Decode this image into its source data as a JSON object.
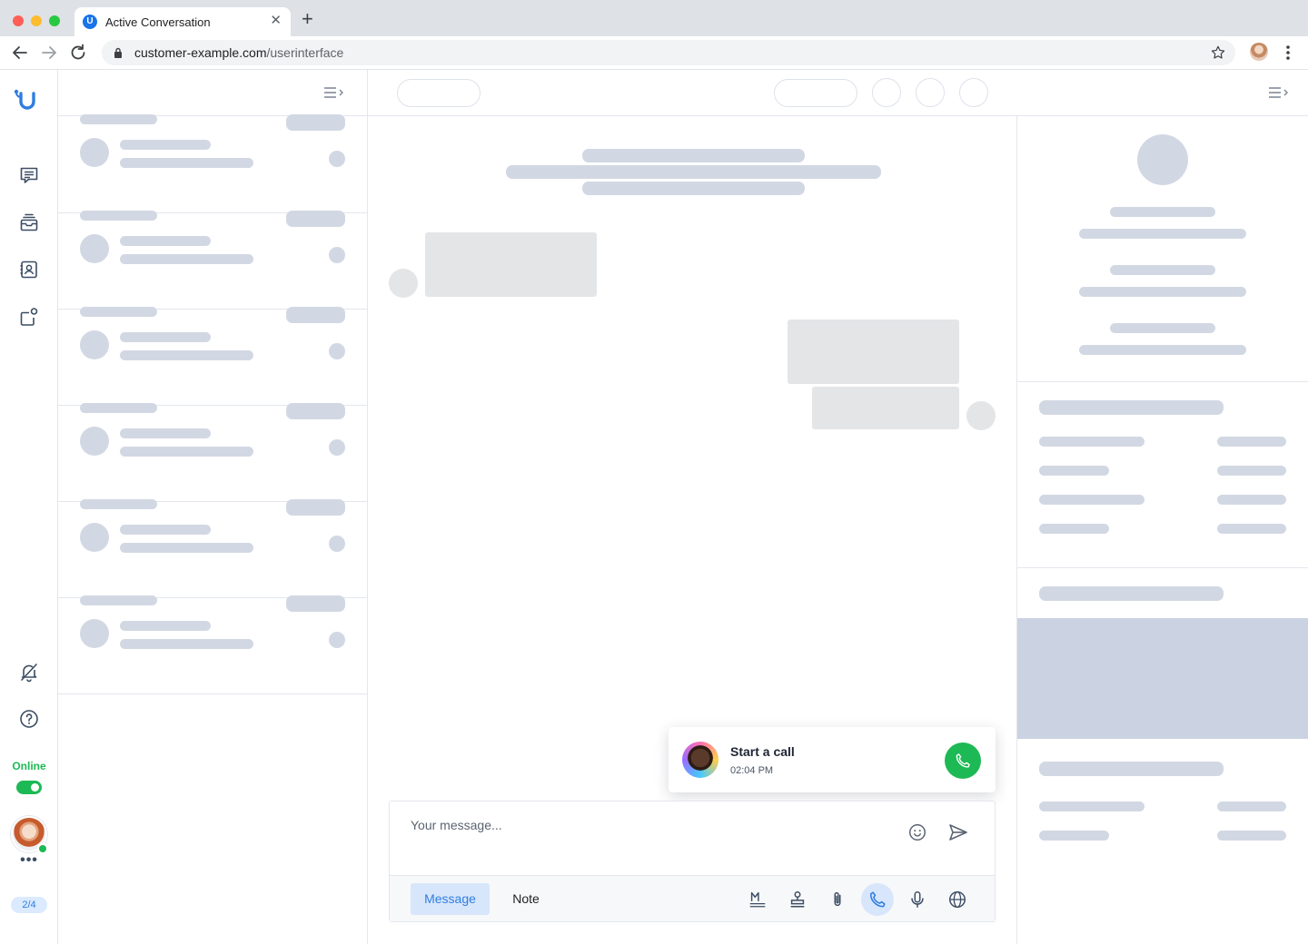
{
  "browser": {
    "tab_title": "Active Conversation",
    "favicon_letter": "U",
    "url_host": "customer-example.com",
    "url_path": "/userinterface"
  },
  "colors": {
    "accent": "#2f7de1",
    "online": "#1db954",
    "skeleton": "#d2d8e3",
    "bubble": "#e4e5e7"
  },
  "rail": {
    "logo": "brand-u-logo",
    "items": [
      {
        "name": "conversations-icon"
      },
      {
        "name": "inbox-stack-icon"
      },
      {
        "name": "contacts-icon"
      },
      {
        "name": "integrations-icon"
      }
    ],
    "bottom": [
      {
        "name": "notifications-muted-icon"
      },
      {
        "name": "help-icon"
      }
    ],
    "status_label": "Online",
    "status_on": true,
    "more_label": "•••",
    "counter": "2/4"
  },
  "conversation_list": {
    "item_count": 6
  },
  "call_notification": {
    "title": "Start a call",
    "time": "02:04 PM"
  },
  "composer": {
    "placeholder": "Your message...",
    "modes": [
      "Message",
      "Note"
    ],
    "active_mode": "Message",
    "tools": [
      "markdown-icon",
      "stamp-icon",
      "attachment-icon",
      "phone-icon",
      "microphone-icon",
      "globe-icon"
    ],
    "active_tool": "phone-icon"
  }
}
